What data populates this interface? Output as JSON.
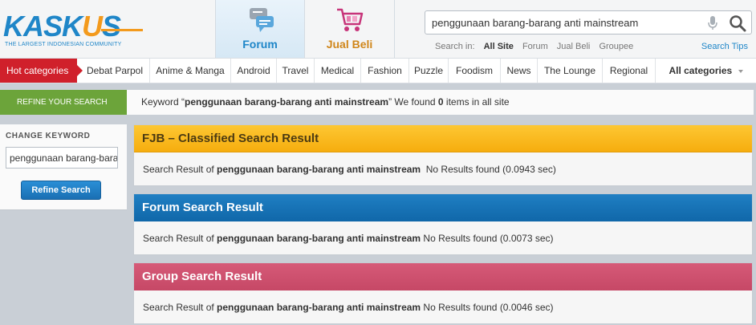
{
  "header": {
    "logo_text_1": "KASK",
    "logo_text_o": "U",
    "logo_text_2": "S",
    "logo_sub": "THE LARGEST INDONESIAN COMMUNITY",
    "nav": [
      {
        "label": "Forum",
        "icon": "forum-icon",
        "active": true
      },
      {
        "label": "Jual Beli",
        "icon": "cart-icon",
        "active": false
      }
    ],
    "search": {
      "value": "penggunaan barang-barang anti mainstream",
      "search_in_label": "Search in:",
      "scopes": [
        "All Site",
        "Forum",
        "Jual Beli",
        "Groupee"
      ],
      "active_scope": "All Site",
      "tips_label": "Search Tips"
    }
  },
  "categories": {
    "hot_label": "Hot categories",
    "items": [
      "Debat Parpol",
      "Anime & Manga",
      "Android",
      "Travel",
      "Medical",
      "Fashion",
      "Puzzle",
      "Foodism",
      "News",
      "The Lounge",
      "Regional"
    ],
    "all_label": "All categories"
  },
  "refine": {
    "tab_label": "REFINE YOUR SEARCH",
    "keyword_prefix": "Keyword “",
    "keyword": "penggunaan barang-barang anti mainstream",
    "keyword_mid": "” We found ",
    "count": "0",
    "keyword_suffix": " items in all site"
  },
  "left_panel": {
    "change_keyword_label": "CHANGE KEYWORD",
    "input_value": "penggunaan barang-barang anti mainstream",
    "button_label": "Refine Search"
  },
  "results": [
    {
      "title": "FJB – Classified Search Result",
      "prefix": "Search Result of ",
      "keyword": "penggunaan barang-barang anti mainstream",
      "status": "  No Results found (0.0943 sec)"
    },
    {
      "title": "Forum Search Result",
      "prefix": "Search Result of ",
      "keyword": "penggunaan barang-barang anti mainstream",
      "status": " No Results found (0.0073 sec)"
    },
    {
      "title": "Group Search Result",
      "prefix": "Search Result of ",
      "keyword": "penggunaan barang-barang anti mainstream",
      "status": " No Results found (0.0046 sec)"
    }
  ],
  "colors": {
    "brand_blue": "#1f86c8",
    "brand_orange": "#f39a1d",
    "hot_red": "#d0202b",
    "refine_green": "#6ca43a",
    "fjb_yellow": "#f6ad0e",
    "forum_blue": "#1067a9",
    "group_pink": "#c64866"
  }
}
